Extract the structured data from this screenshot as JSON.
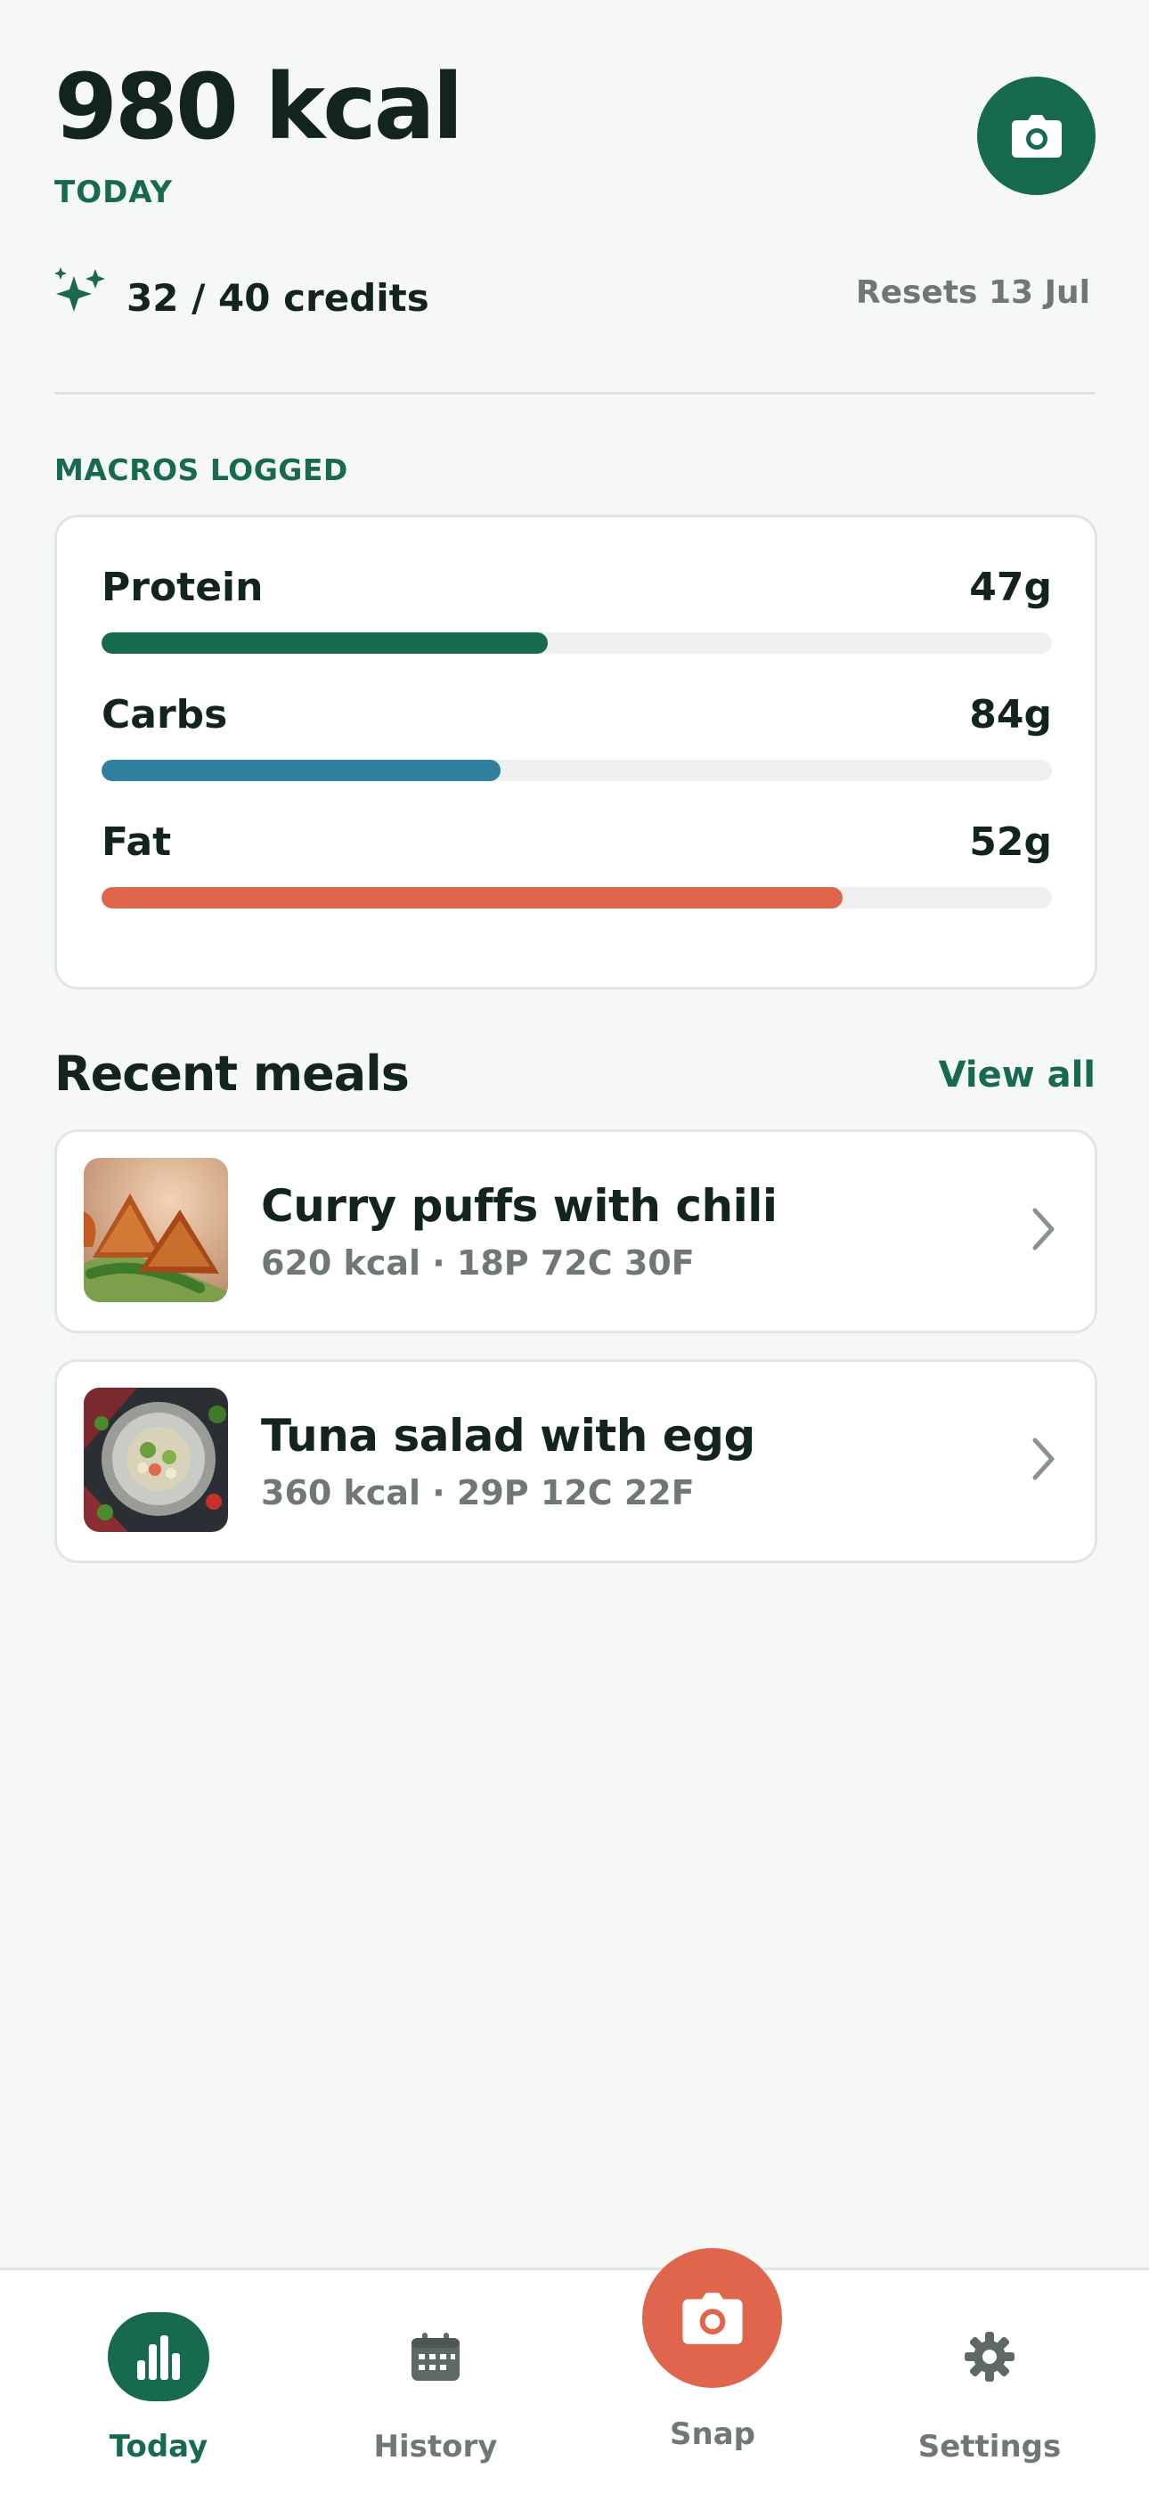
{
  "header": {
    "calories": "980 kcal",
    "period_label": "TODAY"
  },
  "credits": {
    "text": "32 / 40 credits",
    "reset_text": "Resets 13 Jul"
  },
  "macros": {
    "section_label": "MACROS LOGGED",
    "items": [
      {
        "name": "Protein",
        "value": "47g",
        "fill_percent": 47,
        "color": "#17694f"
      },
      {
        "name": "Carbs",
        "value": "84g",
        "fill_percent": 42,
        "color": "#2f7f9e"
      },
      {
        "name": "Fat",
        "value": "52g",
        "fill_percent": 78,
        "color": "#df664c"
      }
    ]
  },
  "recent": {
    "title": "Recent meals",
    "view_all_label": "View all",
    "meals": [
      {
        "name": "Curry puffs with chili",
        "meta": "620 kcal · 18P 72C 30F"
      },
      {
        "name": "Tuna salad with egg",
        "meta": "360 kcal · 29P 12C 22F"
      }
    ]
  },
  "nav": {
    "items": [
      {
        "label": "Today",
        "icon": "bar-chart-icon",
        "active": true
      },
      {
        "label": "History",
        "icon": "calendar-icon",
        "active": false
      },
      {
        "label": "Snap",
        "icon": "camera-icon",
        "active": false
      },
      {
        "label": "Settings",
        "icon": "gear-icon",
        "active": false
      }
    ]
  },
  "colors": {
    "brand_green": "#17694f",
    "accent_coral": "#df664c",
    "carbs_blue": "#2f7f9e"
  }
}
